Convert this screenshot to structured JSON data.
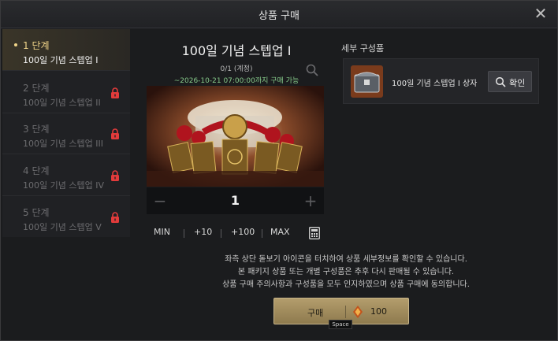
{
  "dialog": {
    "title": "상품 구매",
    "close_icon": "close-icon"
  },
  "steps": [
    {
      "number": "1 단계",
      "name": "100일 기념 스텝업 I",
      "active": true,
      "locked": false
    },
    {
      "number": "2 단계",
      "name": "100일 기념 스텝업 II",
      "active": false,
      "locked": true
    },
    {
      "number": "3 단계",
      "name": "100일 기념 스텝업 III",
      "active": false,
      "locked": true
    },
    {
      "number": "4 단계",
      "name": "100일 기념 스텝업 IV",
      "active": false,
      "locked": true
    },
    {
      "number": "5 단계",
      "name": "100일 기념 스텝업 V",
      "active": false,
      "locked": true
    }
  ],
  "product": {
    "name": "100일 기념 스텝업 I",
    "limit": "0/1 (계정)",
    "period": "~2026-10-21 07:00:00까지 구매 가능",
    "image_icon": "treasure-package-image"
  },
  "quantity": {
    "minus": "−",
    "value": "1",
    "plus": "+"
  },
  "quick_buttons": {
    "min": "MIN",
    "plus10": "+10",
    "plus100": "+100",
    "max": "MAX",
    "calc_icon": "calculator-icon"
  },
  "details": {
    "heading": "세부 구성품",
    "items": [
      {
        "name": "100일 기념 스텝업 I 상자",
        "confirm": "확인",
        "icon": "chest-icon"
      }
    ]
  },
  "notice": [
    "좌측 상단 돋보기 아이콘을 터치하여 상품 세부정보를 확인할 수 있습니다.",
    "본 패키지 상품 또는 개별 구성품은 추후 다시 판매될 수 있습니다.",
    "상품 구매 주의사항과 구성품을 모두 인지하였으며 상품 구매에 동의합니다."
  ],
  "purchase": {
    "label": "구매",
    "price": "100",
    "currency_icon": "gem-icon",
    "hotkey": "Space"
  },
  "colors": {
    "accent_gold": "#f1d58a",
    "period_green": "#86c98a",
    "buy_button": "#b39d6c"
  }
}
